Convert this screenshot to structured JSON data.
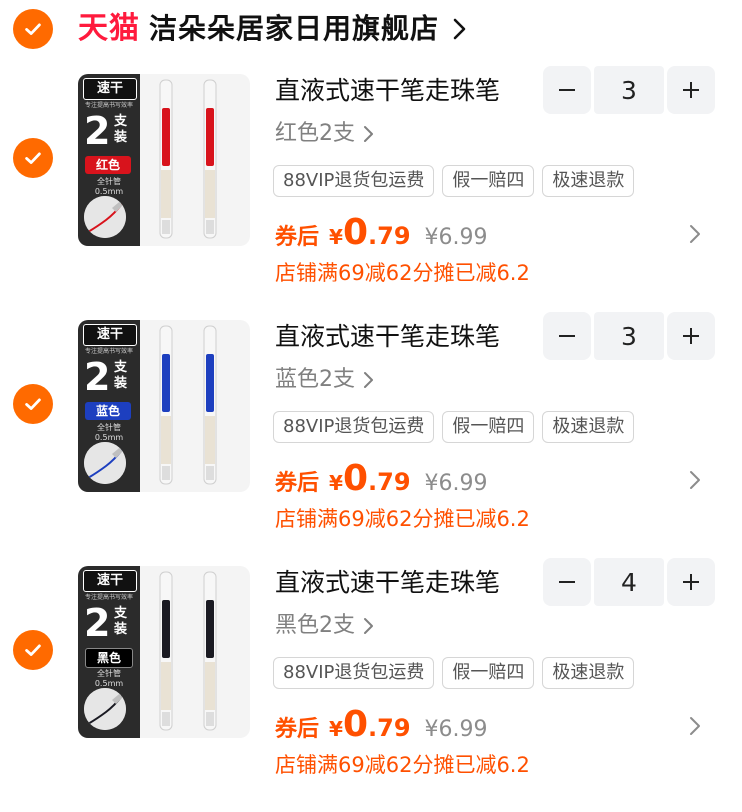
{
  "store": {
    "brand": "天猫",
    "name": "洁朵朵居家日用旗舰店",
    "selected": true
  },
  "colors": {
    "accent": "#ff6a00",
    "price": "#ff5000",
    "tmall_red": "#ff1a3d"
  },
  "items": [
    {
      "title": "直液式速干笔走珠笔",
      "variant": "红色2支",
      "quantity": "3",
      "tags": [
        "88VIP退货包运费",
        "假一赔四",
        "极速退款"
      ],
      "coupon_label": "券后",
      "currency": "¥",
      "price_int": "0",
      "price_dec": ".79",
      "original_price": "¥6.99",
      "discount": "店铺满69减62分摊已减6.2",
      "selected": true,
      "thumb": {
        "top": "速干",
        "sub": "专注提高书写效率",
        "big": "2",
        "unit": "支装",
        "color_label": "红色",
        "tip": "全针管 0.5mm",
        "ink": "#d8131c"
      }
    },
    {
      "title": "直液式速干笔走珠笔",
      "variant": "蓝色2支",
      "quantity": "3",
      "tags": [
        "88VIP退货包运费",
        "假一赔四",
        "极速退款"
      ],
      "coupon_label": "券后",
      "currency": "¥",
      "price_int": "0",
      "price_dec": ".79",
      "original_price": "¥6.99",
      "discount": "店铺满69减62分摊已减6.2",
      "selected": true,
      "thumb": {
        "top": "速干",
        "sub": "专注提高书写效率",
        "big": "2",
        "unit": "支装",
        "color_label": "蓝色",
        "tip": "全针管 0.5mm",
        "ink": "#1d3fbf"
      }
    },
    {
      "title": "直液式速干笔走珠笔",
      "variant": "黑色2支",
      "quantity": "4",
      "tags": [
        "88VIP退货包运费",
        "假一赔四",
        "极速退款"
      ],
      "coupon_label": "券后",
      "currency": "¥",
      "price_int": "0",
      "price_dec": ".79",
      "original_price": "¥6.99",
      "discount": "店铺满69减62分摊已减6.2",
      "selected": true,
      "thumb": {
        "top": "速干",
        "sub": "专注提高书写效率",
        "big": "2",
        "unit": "支装",
        "color_label": "黑色",
        "tip": "全针管 0.5mm",
        "ink": "#1a1a22"
      }
    }
  ],
  "icons": {
    "check": "checkmark-icon",
    "chevron": "chevron-right-icon",
    "minus": "minus-icon",
    "plus": "plus-icon"
  }
}
